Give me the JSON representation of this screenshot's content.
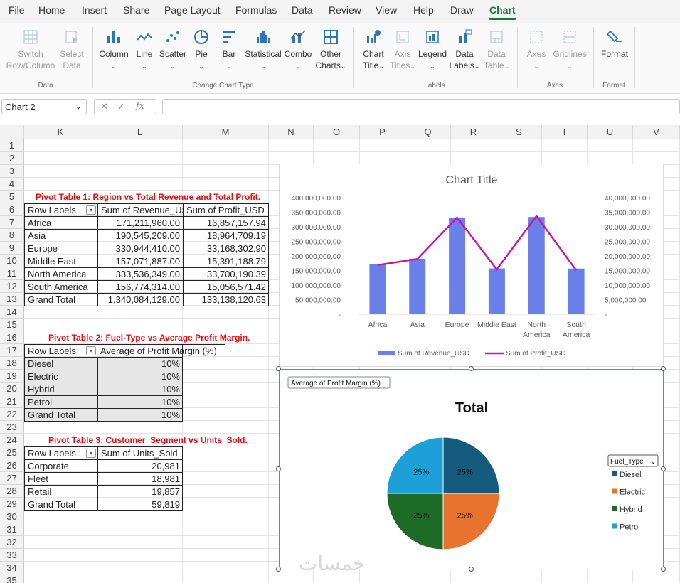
{
  "menu": {
    "items": [
      "File",
      "Home",
      "Insert",
      "Share",
      "Page Layout",
      "Formulas",
      "Data",
      "Review",
      "View",
      "Help",
      "Draw",
      "Chart"
    ],
    "active": "Chart"
  },
  "ribbon": {
    "data_group": {
      "label": "Data",
      "switch": "Switch\nRow/Column",
      "select": "Select\nData"
    },
    "type_group": {
      "label": "Change Chart Type",
      "buttons": [
        "Column",
        "Line",
        "Scatter",
        "Pie",
        "Bar",
        "Statistical",
        "Combo",
        "Other\nCharts"
      ]
    },
    "labels_group": {
      "label": "Labels",
      "buttons": [
        "Chart\nTitle",
        "Axis\nTitles",
        "Legend",
        "Data\nLabels",
        "Data\nTable"
      ]
    },
    "axes_group": {
      "label": "Axes",
      "buttons": [
        "Axes",
        "Gridlines"
      ]
    },
    "format_group": {
      "label": "Format",
      "button": "Format"
    }
  },
  "formula": {
    "name_box": "Chart 2",
    "fx": "fx",
    "value": ""
  },
  "columns": [
    "K",
    "L",
    "M",
    "N",
    "O",
    "P",
    "Q",
    "R",
    "S",
    "T",
    "U",
    "V"
  ],
  "rows": [
    "1",
    "2",
    "3",
    "4",
    "5",
    "6",
    "7",
    "8",
    "9",
    "10",
    "11",
    "12",
    "13",
    "14",
    "15",
    "16",
    "17",
    "18",
    "19",
    "20",
    "21",
    "22",
    "23",
    "24",
    "25",
    "26",
    "27",
    "28",
    "29",
    "30",
    "31",
    "32",
    "33",
    "34",
    "35"
  ],
  "pivot1": {
    "title": "Pivot Table 1: Region vs Total Revenue and Total Profit.",
    "headers": [
      "Row Labels",
      "Sum of Revenue_US",
      "Sum of Profit_USD"
    ],
    "rows": [
      [
        "Africa",
        "171,211,960.00",
        "16,857,157.94"
      ],
      [
        "Asia",
        "190,545,209.00",
        "18,964,709.19"
      ],
      [
        "Europe",
        "330,944,410.00",
        "33,168,302.90"
      ],
      [
        "Middle East",
        "157,071,887.00",
        "15,391,188.79"
      ],
      [
        "North America",
        "333,536,349.00",
        "33,700,190.39"
      ],
      [
        "South America",
        "156,774,314.00",
        "15,056,571.42"
      ],
      [
        "Grand Total",
        "1,340,084,129.00",
        "133,138,120.63"
      ]
    ]
  },
  "pivot2": {
    "title": "Pivot Table 2: Fuel-Type vs Average Profit Margin.",
    "headers": [
      "Row Labels",
      "Average of Profit Margin (%)"
    ],
    "rows": [
      [
        "Diesel",
        "10%"
      ],
      [
        "Electric",
        "10%"
      ],
      [
        "Hybrid",
        "10%"
      ],
      [
        "Petrol",
        "10%"
      ],
      [
        "Grand Total",
        "10%"
      ]
    ]
  },
  "pivot3": {
    "title": "Pivot Table 3: Customer_Segment vs Units_Sold.",
    "headers": [
      "Row Labels",
      "Sum of Units_Sold"
    ],
    "rows": [
      [
        "Corporate",
        "20,981"
      ],
      [
        "Fleet",
        "18,981"
      ],
      [
        "Retail",
        "19,857"
      ],
      [
        "Grand Total",
        "59,819"
      ]
    ]
  },
  "chart_data": [
    {
      "type": "bar",
      "title": "Chart Title",
      "categories": [
        "Africa",
        "Asia",
        "Europe",
        "Middle East",
        "North America",
        "South America"
      ],
      "series": [
        {
          "name": "Sum of Revenue_USD",
          "values": [
            171211960,
            190545209,
            330944410,
            157071887,
            333536349,
            156774314
          ],
          "axis": "primary",
          "kind": "bar",
          "color": "#6a7fe8"
        },
        {
          "name": "Sum of Profit_USD",
          "values": [
            16857157.94,
            18964709.19,
            33168302.9,
            15391188.79,
            33700190.39,
            15056571.42
          ],
          "axis": "secondary",
          "kind": "line",
          "color": "#c417a3"
        }
      ],
      "ylim": [
        0,
        400000000
      ],
      "y2lim": [
        0,
        40000000
      ],
      "yticks": [
        "400,000,000.00",
        "350,000,000.00",
        "300,000,000.00",
        "250,000,000.00",
        "200,000,000.00",
        "150,000,000.00",
        "100,000,000.00",
        "50,000,000.00",
        "-"
      ],
      "y2ticks": [
        "40,000,000.00",
        "35,000,000.00",
        "30,000,000.00",
        "25,000,000.00",
        "20,000,000.00",
        "15,000,000.00",
        "10,000,000.00",
        "5,000,000.00",
        "-"
      ],
      "legend": "bottom"
    },
    {
      "type": "pie",
      "title": "Total",
      "field_button": "Average of Profit Margin (%)",
      "legend_field": "Fuel_Type",
      "categories": [
        "Diesel",
        "Electric",
        "Hybrid",
        "Petrol"
      ],
      "values": [
        25,
        25,
        25,
        25
      ],
      "labels": [
        "25%",
        "25%",
        "25%",
        "25%"
      ],
      "colors": [
        "#145b7d",
        "#e8732f",
        "#1d6b26",
        "#1d9fd8"
      ],
      "legend": "right"
    }
  ],
  "watermark": "خمسات"
}
